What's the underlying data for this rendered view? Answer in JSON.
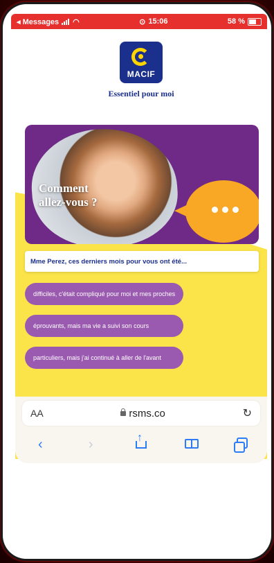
{
  "status_bar": {
    "back_app": "◂ Messages",
    "time": "15:06",
    "battery": "58 %"
  },
  "brand": {
    "logo_text": "MACIF",
    "tagline": "Essentiel pour moi"
  },
  "hero": {
    "line1": "Comment",
    "line2": "allez-vous ?"
  },
  "question": "Mme Perez, ces derniers mois pour vous ont été...",
  "options": [
    "difficiles, c'était compliqué pour moi et mes proches",
    "éprouvants, mais ma vie a suivi son cours",
    "particuliers, mais j'ai continué à aller de l'avant"
  ],
  "browser": {
    "aa_label": "AA",
    "url": "rsms.co",
    "reload_icon": "reload-icon"
  },
  "toolbar": {
    "back_icon": "‹",
    "forward_icon": "›"
  },
  "colors": {
    "purple": "#6e2a86",
    "option_purple": "#9a5ab0",
    "yellow": "#fbe44a",
    "orange": "#f9a825",
    "navy": "#1b2f8d",
    "ios_blue": "#2b7cf6",
    "status_red": "#e5302e"
  }
}
